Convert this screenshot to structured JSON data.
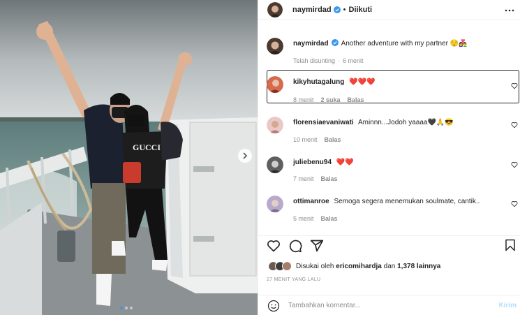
{
  "post": {
    "author": "naymirdad",
    "follow_status": "Diikuti",
    "caption": "Another adventure with my partner",
    "caption_emoji": "😌👩‍❤️‍👨",
    "edited_label": "Telah disunting",
    "edited_time": "6 menit"
  },
  "comments": [
    {
      "user": "kikyhutagalung",
      "text": "❤️❤️❤️",
      "time": "8 menit",
      "likes": "2 suka",
      "reply": "Balas"
    },
    {
      "user": "florensiaevaniwati",
      "text": "Aminnn...Jodoh yaaaa🖤🙏😎",
      "time": "10 menit",
      "reply": "Balas"
    },
    {
      "user": "juliebenu94",
      "text": "❤️❤️",
      "time": "7 menit",
      "reply": "Balas"
    },
    {
      "user": "ottimanroe",
      "text": "Semoga segera menemukan soulmate, cantik..",
      "time": "5 menit",
      "reply": "Balas"
    }
  ],
  "likes": {
    "prefix": "Disukai oleh",
    "user": "ericomihardja",
    "middle": "dan",
    "count": "1,378 lainnya"
  },
  "timestamp": "27 MENIT YANG LALU",
  "add_comment": {
    "placeholder": "Tambahkan komentar...",
    "post_label": "Kirim"
  },
  "icons": {
    "verified": "verified-badge-icon",
    "more": "more-options-icon",
    "like": "heart-icon",
    "comment": "comment-icon",
    "share": "share-icon",
    "save": "bookmark-icon",
    "emoji": "emoji-icon",
    "next": "chevron-right-icon"
  },
  "colors": {
    "verified": "#3897f0",
    "heart_red": "#ed4956",
    "link_disabled": "#b2dffc"
  }
}
